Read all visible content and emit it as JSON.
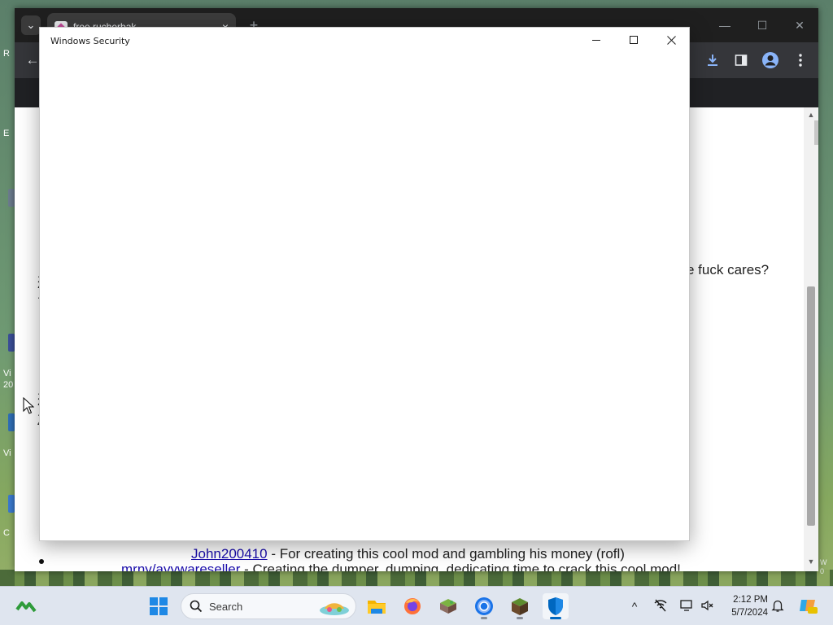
{
  "browser": {
    "tab_title": "free rucherbak",
    "tab_close_glyph": "×",
    "new_tab_glyph": "+",
    "back_glyph": "←",
    "window_controls": {
      "minimize": "—",
      "maximize": "☐",
      "close": "✕"
    }
  },
  "page": {
    "partial_line": "e fuck cares?",
    "credits": [
      {
        "link": "John200410",
        "text": " - For creating this cool mod and gambling his money (rofl)"
      },
      {
        "link": "mrny/avywareseller",
        "text": " - Creating the dumper, dumping, dedicating time to crack this cool mod!"
      }
    ],
    "scroll_up_glyph": "▲",
    "scroll_down_glyph": "▼"
  },
  "security_window": {
    "title": "Windows Security"
  },
  "taskbar": {
    "search_label": "Search",
    "time": "2:12 PM",
    "date": "5/7/2024",
    "chevron_glyph": "^",
    "items": [
      {
        "name": "windows-start",
        "active": false
      },
      {
        "name": "file-explorer",
        "active": false
      },
      {
        "name": "firefox",
        "active": false
      },
      {
        "name": "minecraft-launcher-map",
        "active": false
      },
      {
        "name": "chrome",
        "active": false
      },
      {
        "name": "minecraft-grass-block",
        "active": false
      },
      {
        "name": "windows-security",
        "active": true
      }
    ]
  },
  "desktop": {
    "left_labels": [
      "R",
      "E",
      "Vi",
      "20",
      "Vi",
      "C"
    ],
    "right_label_lines": [
      "W",
      "0"
    ]
  },
  "colors": {
    "taskbar_bg": "#dfe5ef",
    "accent": "#0067c0",
    "link": "#1a0dab",
    "chrome_dark": "#202124"
  }
}
